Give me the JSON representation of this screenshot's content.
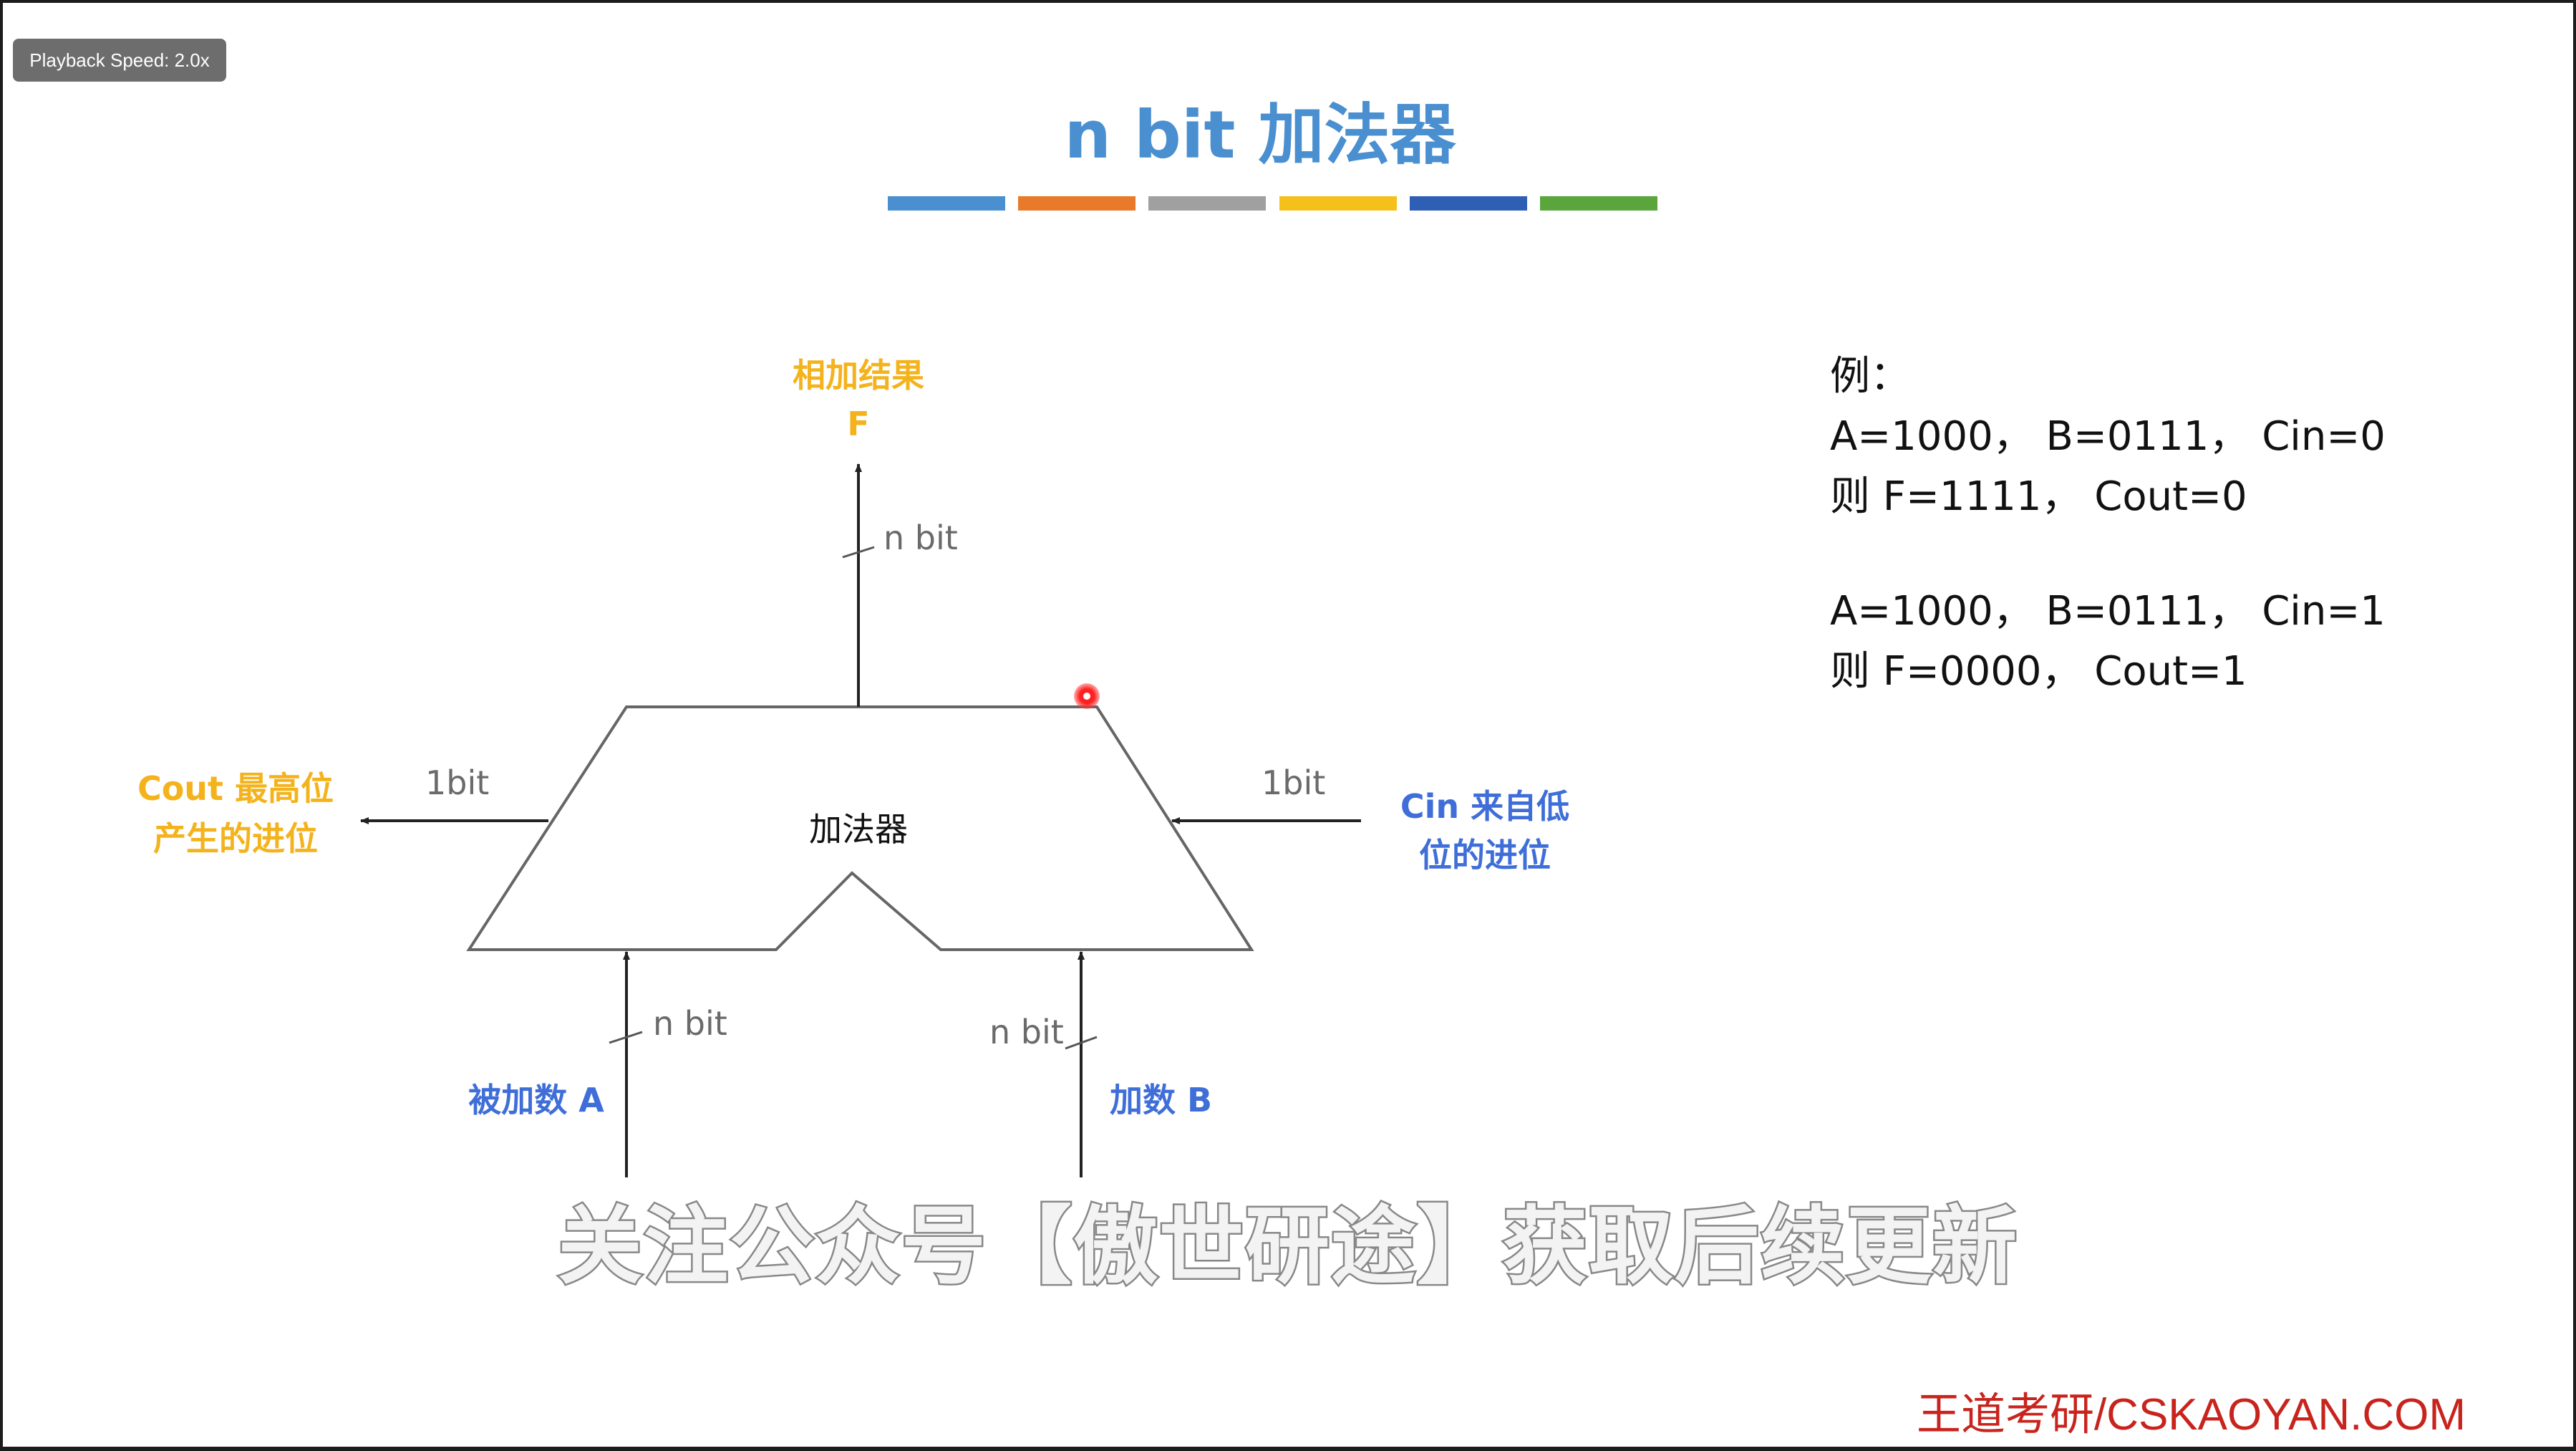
{
  "overlay": {
    "playback_speed": "Playback Speed: 2.0x"
  },
  "slide": {
    "title": "n bit 加法器",
    "color_bars": [
      "#4a90d0",
      "#e87a2a",
      "#a0a0a0",
      "#f5c01a",
      "#2e5fb5",
      "#5aa63c"
    ]
  },
  "diagram": {
    "block_label": "加法器",
    "output": {
      "label_line1": "相加结果",
      "label_line2": "F",
      "width": "n bit"
    },
    "cout": {
      "label_line1": "Cout 最高位",
      "label_line2": "产生的进位",
      "width": "1bit"
    },
    "cin": {
      "label_line1": "Cin 来自低",
      "label_line2": "位的进位",
      "width": "1bit"
    },
    "input_a": {
      "label": "被加数 A",
      "width": "n bit"
    },
    "input_b": {
      "label": "加数 B",
      "width": "n bit"
    }
  },
  "example": {
    "heading": "例：",
    "case1_inputs": "A=1000， B=0111， Cin=0",
    "case1_result": "则 F=1111，  Cout=0",
    "case2_inputs": "A=1000， B=0111， Cin=1",
    "case2_result": "则 F=0000， Cout=1"
  },
  "subtitle": "关注公众号【傲世研途】获取后续更新",
  "watermark": "王道考研/CSKAOYAN.COM",
  "colors": {
    "title": "#4a8fd0",
    "yellow_label": "#f4b31c",
    "blue_label": "#3f6ed8",
    "watermark": "#c8241d",
    "pointer": "#ff2020"
  }
}
